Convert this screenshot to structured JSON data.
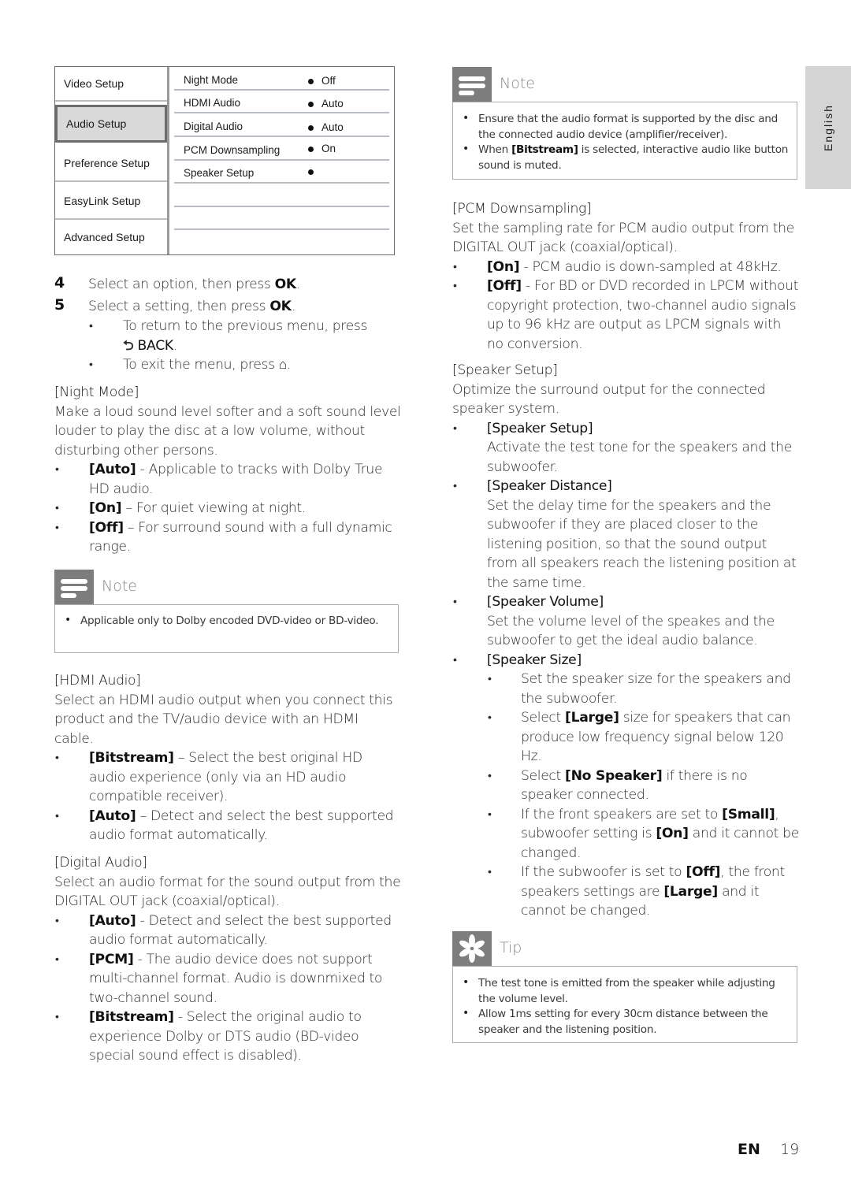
{
  "menu": {
    "left_items": [
      {
        "label": "Video Setup",
        "selected": false
      },
      {
        "label": "Audio Setup",
        "selected": true
      },
      {
        "label": "Preference Setup",
        "selected": false
      },
      {
        "label": "EasyLink Setup",
        "selected": false
      },
      {
        "label": "Advanced Setup",
        "selected": false
      }
    ],
    "right_items": [
      {
        "label": "Night Mode",
        "value": "Off"
      },
      {
        "label": "HDMI Audio",
        "value": "Auto"
      },
      {
        "label": "Digital Audio",
        "value": "Auto"
      },
      {
        "label": "PCM Downsampling",
        "value": "On"
      },
      {
        "label": "Speaker Setup",
        "value": ""
      }
    ]
  },
  "steps": [
    {
      "num": "4",
      "text": "Select an option, then press ",
      "key": "OK",
      "end": "."
    },
    {
      "num": "5",
      "text": "Select a setting, then press ",
      "key": "OK",
      "end": "."
    }
  ],
  "step_bullets": {
    "back_text": "To return to the previous menu, press",
    "back_key": "BACK",
    "exit_text": "To exit the menu, press",
    "back_icon": "back-arrow-icon",
    "home_icon": "home-icon"
  },
  "night_mode": {
    "heading": "[Night Mode]",
    "desc": "Make a loud sound level softer and a soft sound level louder to play the disc at a low volume, without disturbing other persons.",
    "options": [
      {
        "key": "[Auto]",
        "text": " - Applicable to tracks with Dolby True HD audio."
      },
      {
        "key": "[On]",
        "text": " – For quiet viewing at night."
      },
      {
        "key": "[Off]",
        "text": " – For surround sound with a full dynamic range."
      }
    ]
  },
  "note1": {
    "title": "Note",
    "items": [
      "Applicable only to Dolby encoded DVD-video or BD-video."
    ]
  },
  "hdmi_audio": {
    "heading": "[HDMI Audio]",
    "desc": "Select an HDMI audio output when you connect this product and the TV/audio device with an HDMI cable.",
    "options": [
      {
        "key": "[Bitstream]",
        "text": " – Select the best original HD audio experience (only via an HD audio compatible receiver)."
      },
      {
        "key": "[Auto]",
        "text": " – Detect and select the best supported audio format automatically."
      }
    ]
  },
  "digital_audio": {
    "heading": "[Digital Audio]",
    "desc": "Select an audio format for the sound output from the DIGITAL OUT jack (coaxial/optical).",
    "options": [
      {
        "key": "[Auto]",
        "text": " - Detect and select the best supported audio format automatically."
      },
      {
        "key": "[PCM]",
        "text": " - The audio device does not support multi-channel format. Audio is downmixed to two-channel sound."
      },
      {
        "key": "[Bitstream]",
        "text": " - Select the original audio to experience Dolby or DTS audio (BD-video special sound effect is disabled)."
      }
    ]
  },
  "note2": {
    "title": "Note",
    "item1": "Ensure that the audio format is supported by the disc and the connected audio device (amplifier/receiver).",
    "item2_pre": "When ",
    "item2_key": "[Bitstream]",
    "item2_post": " is selected, interactive audio like button sound is muted."
  },
  "pcm": {
    "heading": "[PCM Downsampling]",
    "desc": "Set the sampling rate for PCM audio output from the DIGITAL OUT jack (coaxial/optical).",
    "options": [
      {
        "key": "[On]",
        "text": " - PCM audio is down-sampled at 48kHz."
      },
      {
        "key": "[Off]",
        "text": " - For BD or DVD recorded in LPCM without copyright protection, two-channel audio signals up to 96 kHz are output as LPCM signals with no conversion."
      }
    ]
  },
  "speaker": {
    "heading": "[Speaker Setup]",
    "desc": "Optimize the surround output for the connected speaker system.",
    "items": [
      {
        "key": "[Speaker Setup]",
        "text": "Activate the test tone for the speakers and the subwoofer."
      },
      {
        "key": "[Speaker Distance]",
        "text": "Set the delay time for the speakers and the subwoofer if they are placed closer to the listening position, so that the sound output from all speakers reach the listening position at the same time."
      },
      {
        "key": "[Speaker Volume]",
        "text": "Set the volume level of the speakes and the subwoofer to get the ideal audio balance."
      },
      {
        "key": "[Speaker Size]"
      }
    ],
    "size_sub": {
      "s1": "Set the speaker size for the speakers and the subwoofer.",
      "s2_pre": "Select ",
      "s2_key": "[Large]",
      "s2_post": " size for speakers that can produce low frequency signal below 120 Hz.",
      "s3_pre": "Select ",
      "s3_key": "[No Speaker]",
      "s3_post": " if there is no speaker connected.",
      "s4_pre": "If the front speakers are set to ",
      "s4_key": "[Small]",
      "s4_mid": ", subwoofer setting is ",
      "s4_key2": "[On]",
      "s4_post": " and it cannot be changed.",
      "s5_pre": "If the subwoofer is set to ",
      "s5_key": "[Off]",
      "s5_mid": ", the front speakers settings are ",
      "s5_key2": "[Large]",
      "s5_post": " and it cannot be changed."
    }
  },
  "tip": {
    "title": "Tip",
    "items": [
      "The test tone is emitted from the speaker while adjusting the volume level.",
      "Allow 1ms setting for every 30cm distance between the speaker and the listening position."
    ]
  },
  "side_tab": {
    "label": "English"
  },
  "footer": {
    "lang": "EN",
    "page": "19"
  }
}
